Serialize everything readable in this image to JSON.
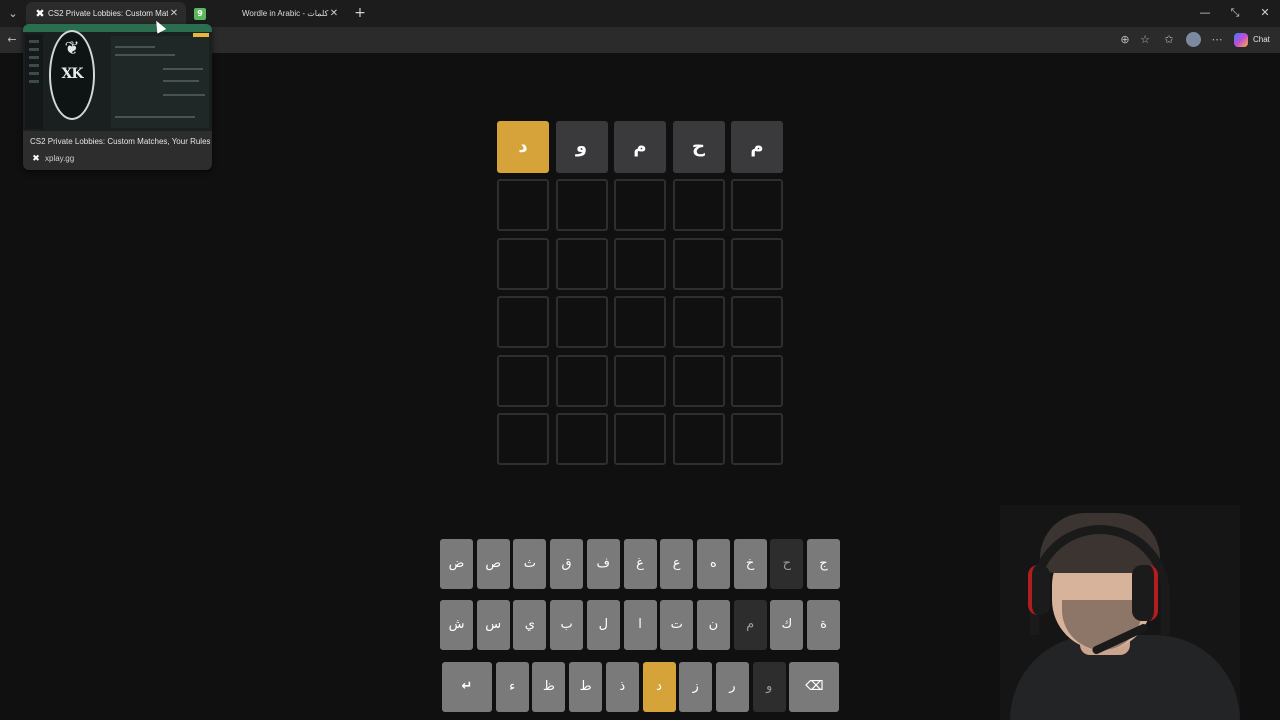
{
  "browser": {
    "tabs": [
      {
        "title": "CS2 Private Lobbies: Custom Matches, Your Rules",
        "active": true
      },
      {
        "title": "Wordle in Arabic - كلمات",
        "active": false
      }
    ],
    "hover_card": {
      "title": "CS2 Private Lobbies: Custom Matches, Your Rules",
      "domain": "xplay.gg",
      "thumb_logo_text": "XK"
    },
    "copilot_label": "Chat"
  },
  "board": {
    "rows": [
      [
        {
          "letter": "د",
          "state": "present"
        },
        {
          "letter": "و",
          "state": "absent"
        },
        {
          "letter": "م",
          "state": "absent"
        },
        {
          "letter": "ح",
          "state": "absent"
        },
        {
          "letter": "م",
          "state": "absent"
        }
      ],
      [
        {
          "letter": "",
          "state": "empty"
        },
        {
          "letter": "",
          "state": "empty"
        },
        {
          "letter": "",
          "state": "empty"
        },
        {
          "letter": "",
          "state": "empty"
        },
        {
          "letter": "",
          "state": "empty"
        }
      ],
      [
        {
          "letter": "",
          "state": "empty"
        },
        {
          "letter": "",
          "state": "empty"
        },
        {
          "letter": "",
          "state": "empty"
        },
        {
          "letter": "",
          "state": "empty"
        },
        {
          "letter": "",
          "state": "empty"
        }
      ],
      [
        {
          "letter": "",
          "state": "empty"
        },
        {
          "letter": "",
          "state": "empty"
        },
        {
          "letter": "",
          "state": "empty"
        },
        {
          "letter": "",
          "state": "empty"
        },
        {
          "letter": "",
          "state": "empty"
        }
      ],
      [
        {
          "letter": "",
          "state": "empty"
        },
        {
          "letter": "",
          "state": "empty"
        },
        {
          "letter": "",
          "state": "empty"
        },
        {
          "letter": "",
          "state": "empty"
        },
        {
          "letter": "",
          "state": "empty"
        }
      ],
      [
        {
          "letter": "",
          "state": "empty"
        },
        {
          "letter": "",
          "state": "empty"
        },
        {
          "letter": "",
          "state": "empty"
        },
        {
          "letter": "",
          "state": "empty"
        },
        {
          "letter": "",
          "state": "empty"
        }
      ]
    ]
  },
  "keyboard": {
    "rows": [
      [
        {
          "label": "ض",
          "state": "unused"
        },
        {
          "label": "ص",
          "state": "unused"
        },
        {
          "label": "ث",
          "state": "unused"
        },
        {
          "label": "ق",
          "state": "unused"
        },
        {
          "label": "ف",
          "state": "unused"
        },
        {
          "label": "غ",
          "state": "unused"
        },
        {
          "label": "ع",
          "state": "unused"
        },
        {
          "label": "ه",
          "state": "unused"
        },
        {
          "label": "خ",
          "state": "unused"
        },
        {
          "label": "ح",
          "state": "absent"
        },
        {
          "label": "ج",
          "state": "unused"
        }
      ],
      [
        {
          "label": "ش",
          "state": "unused"
        },
        {
          "label": "س",
          "state": "unused"
        },
        {
          "label": "ي",
          "state": "unused"
        },
        {
          "label": "ب",
          "state": "unused"
        },
        {
          "label": "ل",
          "state": "unused"
        },
        {
          "label": "ا",
          "state": "unused"
        },
        {
          "label": "ت",
          "state": "unused"
        },
        {
          "label": "ن",
          "state": "unused"
        },
        {
          "label": "م",
          "state": "absent"
        },
        {
          "label": "ك",
          "state": "unused"
        },
        {
          "label": "ة",
          "state": "unused"
        }
      ],
      [
        {
          "label": "↵",
          "state": "unused",
          "kind": "enter"
        },
        {
          "label": "ء",
          "state": "unused"
        },
        {
          "label": "ظ",
          "state": "unused"
        },
        {
          "label": "ط",
          "state": "unused"
        },
        {
          "label": "ذ",
          "state": "unused"
        },
        {
          "label": "د",
          "state": "present"
        },
        {
          "label": "ز",
          "state": "unused"
        },
        {
          "label": "ر",
          "state": "unused"
        },
        {
          "label": "و",
          "state": "absent"
        },
        {
          "label": "⌫",
          "state": "unused",
          "kind": "backspace"
        }
      ]
    ]
  },
  "colors": {
    "present": "#d5a33a",
    "absent": "#3a3a3c",
    "key_unused": "#7a7a7a",
    "key_absent": "#2d2d2d"
  }
}
